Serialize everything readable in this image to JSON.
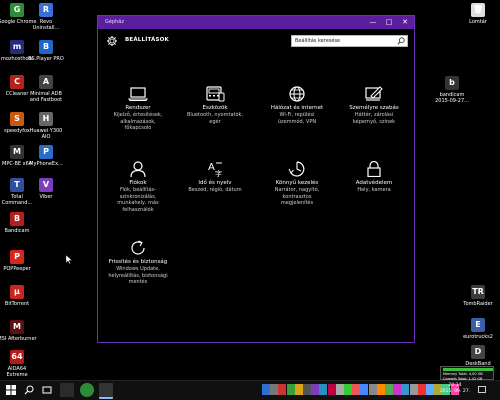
{
  "desktop_left": [
    {
      "label": "Google Chrome",
      "color": "#2e8b3a",
      "glyph": "G"
    },
    {
      "label": "Revo Uninstall...",
      "color": "#3a6fd8",
      "glyph": "R"
    },
    {
      "label": "mozhosthole",
      "color": "#2a2a7a",
      "glyph": "m"
    },
    {
      "label": "BS.Player PRO",
      "color": "#1e66c7",
      "glyph": "B"
    },
    {
      "label": "CCleaner",
      "color": "#b3221c",
      "glyph": "C"
    },
    {
      "label": "Minimal ADB and Fastboot",
      "color": "#444",
      "glyph": "A"
    },
    {
      "label": "speedyfox",
      "color": "#c75a12",
      "glyph": "S"
    },
    {
      "label": "Huawei Y300 AIO",
      "color": "#666",
      "glyph": "H"
    },
    {
      "label": "MPC-BE x64",
      "color": "#333",
      "glyph": "M"
    },
    {
      "label": "MyPhoneEx...",
      "color": "#2a6dc9",
      "glyph": "P"
    },
    {
      "label": "Total Command...",
      "color": "#2f4e9e",
      "glyph": "T"
    },
    {
      "label": "Viber",
      "color": "#7b3fbd",
      "glyph": "V"
    },
    {
      "label": "Bandicam",
      "color": "#b51f1f",
      "glyph": "B"
    },
    {
      "label": "POPPeeper",
      "color": "#d8261f",
      "glyph": "P"
    },
    {
      "label": "BitTorrent",
      "color": "#c9261f",
      "glyph": "µ"
    },
    {
      "label": "MSI Afterburner",
      "color": "#5c1010",
      "glyph": "M"
    },
    {
      "label": "AIDA64 Extreme",
      "color": "#b81a1a",
      "glyph": "64"
    }
  ],
  "desktop_right": [
    {
      "label": "Lomtár",
      "color": "#dddddd",
      "glyph": "🗑"
    },
    {
      "label": "bandicam 2015-09-27...",
      "color": "#333",
      "glyph": "b"
    },
    {
      "label": "TombRaider",
      "color": "#3c3c3c",
      "glyph": "TR"
    },
    {
      "label": "eurotrucks2",
      "color": "#3a5ea8",
      "glyph": "E"
    },
    {
      "label": "DeskBand",
      "color": "#444",
      "glyph": "D"
    }
  ],
  "window": {
    "title": "Gépház",
    "minimize": "—",
    "maximize": "□",
    "close": "✕",
    "header_title": "BEÁLLÍTÁSOK",
    "search_placeholder": "Beállítás keresése"
  },
  "tiles": [
    {
      "icon": "laptop-icon",
      "title": "Rendszer",
      "desc": "Kijelző, értesítések,\nalkalmazások,\nfőkapcsoló"
    },
    {
      "icon": "devices-icon",
      "title": "Eszközök",
      "desc": "Bluetooth, nyomtatók,\negér"
    },
    {
      "icon": "globe-icon",
      "title": "Hálózat és internet",
      "desc": "Wi-Fi, repülési\nüzemmód, VPN"
    },
    {
      "icon": "personalize-icon",
      "title": "Személyre szabás",
      "desc": "Háttér, zárolási\nképernyő, színek"
    },
    {
      "icon": "user-icon",
      "title": "Fiókok",
      "desc": "Fiók, beállítás-\nszinkronizálás,\nmunkahely, más\nfelhasználók"
    },
    {
      "icon": "time-language-icon",
      "title": "Idő és nyelv",
      "desc": "Beszéd, régió, dátum"
    },
    {
      "icon": "ease-of-access-icon",
      "title": "Könnyű kezelés",
      "desc": "Narrátor, nagyító,\nkontrasztos\nmegjelenítés"
    },
    {
      "icon": "lock-icon",
      "title": "Adatvédelem",
      "desc": "Hely, kamera"
    },
    {
      "icon": "update-icon",
      "title": "Frissítés és biztonság",
      "desc": "Windows Update,\nhelyreállítás, biztonsági\nmentés"
    }
  ],
  "overlay": {
    "line1": "Memory Total: 4,00 GB",
    "line2": "Commit Total: 1,42 GB"
  },
  "clock": {
    "time": "20:14",
    "date": "2015. 09. 27."
  },
  "colors": {
    "accent": "#5b1f9e",
    "border": "#6b2fb8"
  }
}
